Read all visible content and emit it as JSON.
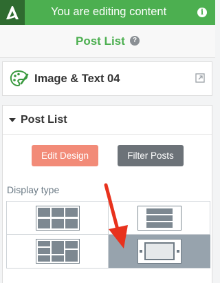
{
  "header": {
    "title": "You are editing content",
    "logo_icon": "brand-a-logo-icon",
    "info_icon": "info-icon",
    "bg_color": "#4caf50"
  },
  "subheader": {
    "title": "Post List",
    "help_icon": "help-question-icon",
    "help_glyph": "?"
  },
  "content_item": {
    "title": "Image & Text 04",
    "icon": "palette-icon",
    "open_icon": "external-link-icon"
  },
  "panel": {
    "title": "Post List",
    "caret_icon": "caret-down-icon",
    "edit_design_label": "Edit Design",
    "filter_posts_label": "Filter Posts",
    "display_type_label": "Display type",
    "display_options": [
      {
        "icon": "grid-layout-icon",
        "selected": false
      },
      {
        "icon": "list-layout-icon",
        "selected": false
      },
      {
        "icon": "mixed-layout-icon",
        "selected": false
      },
      {
        "icon": "slider-layout-icon",
        "selected": true
      }
    ]
  },
  "colors": {
    "accent_green": "#4caf50",
    "edit_button": "#f28b78",
    "filter_button": "#6c7278",
    "selected_option": "#97a3ad",
    "annotation_arrow": "#e8321d"
  }
}
